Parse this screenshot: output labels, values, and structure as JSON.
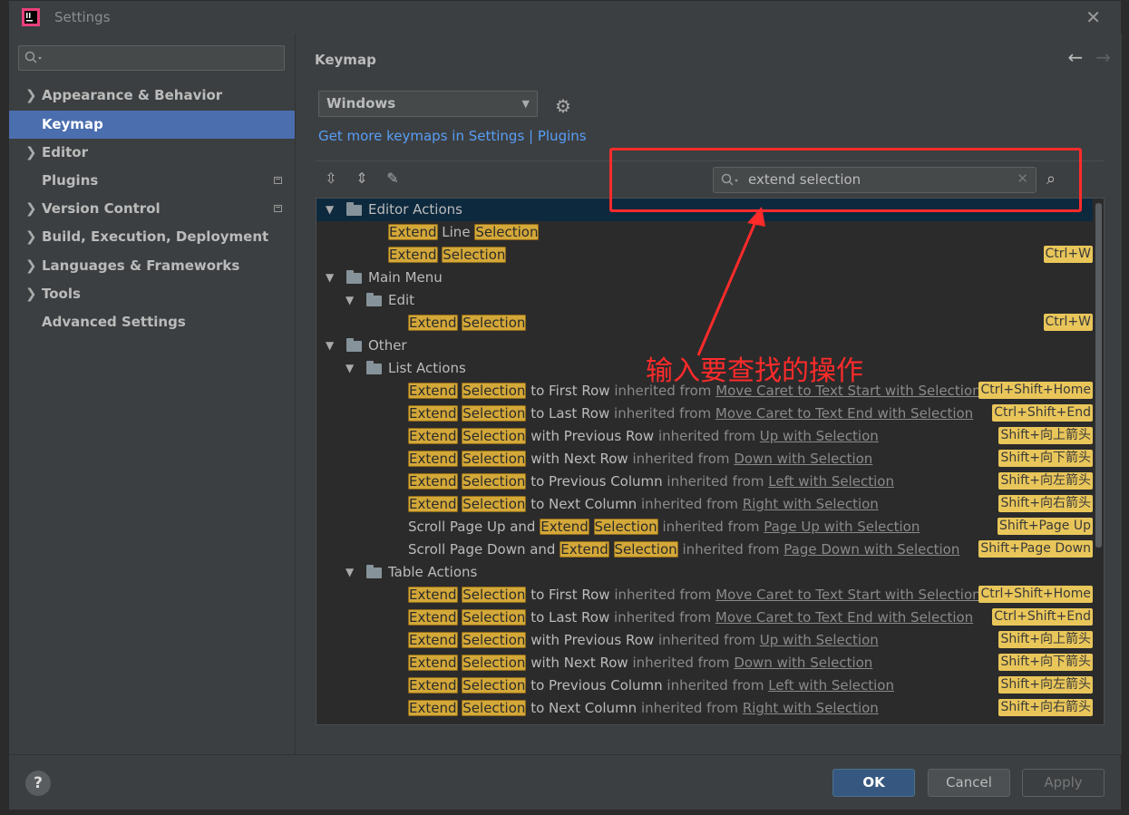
{
  "window": {
    "title": "Settings"
  },
  "sidebar": {
    "items": [
      {
        "label": "Appearance & Behavior"
      },
      {
        "label": "Keymap"
      },
      {
        "label": "Editor"
      },
      {
        "label": "Plugins"
      },
      {
        "label": "Version Control"
      },
      {
        "label": "Build, Execution, Deployment"
      },
      {
        "label": "Languages & Frameworks"
      },
      {
        "label": "Tools"
      },
      {
        "label": "Advanced Settings"
      }
    ]
  },
  "content": {
    "breadcrumb": "Keymap",
    "keymap_select": "Windows",
    "link": "Get more keymaps in Settings | Plugins",
    "search_value": "extend selection"
  },
  "tree": {
    "editor_actions": "Editor Actions",
    "main_menu": "Main Menu",
    "edit": "Edit",
    "other": "Other",
    "list_actions": "List Actions",
    "table_actions": "Table Actions",
    "w_extend": "Extend",
    "w_selection": "Selection",
    "w_line": "Line",
    "inherited": "inherited from",
    "scroll_up": "Scroll Page Up and",
    "scroll_down": "Scroll Page Down and",
    "suffixes": [
      "to First Row",
      "to Last Row",
      "with Previous Row",
      "with Next Row",
      "to Previous Column",
      "to Next Column"
    ],
    "sources": [
      "Move Caret to Text Start with Selection",
      "Move Caret to Text End with Selection",
      "Up with Selection",
      "Down with Selection",
      "Left with Selection",
      "Right with Selection",
      "Page Up with Selection",
      "Page Down with Selection"
    ],
    "shortcuts": [
      "Ctrl+W",
      "Ctrl+Shift+Home",
      "Ctrl+Shift+End",
      "Shift+向上箭头",
      "Shift+向下箭头",
      "Shift+向左箭头",
      "Shift+向右箭头",
      "Shift+Page Up",
      "Shift+Page Down"
    ]
  },
  "annotation": "输入要查找的操作",
  "footer": {
    "help": "?",
    "ok": "OK",
    "cancel": "Cancel",
    "apply": "Apply"
  },
  "colors": {
    "accent": "#4b6eaf",
    "highlight": "#d4a838",
    "annotation": "#ff2b2b"
  }
}
